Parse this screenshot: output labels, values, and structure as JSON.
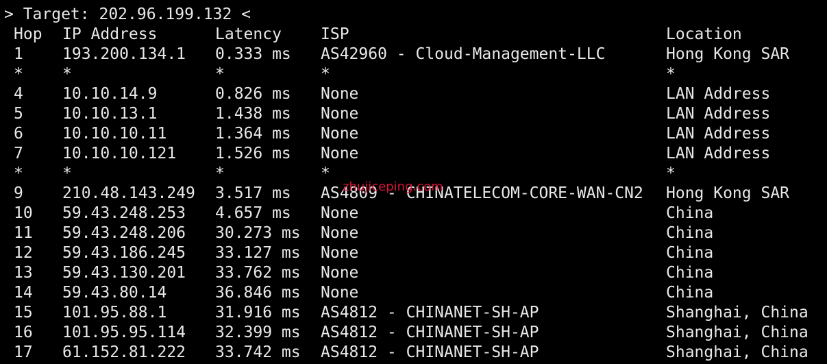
{
  "terminal": {
    "target_line": "> Target: 202.96.199.132 <",
    "headers": {
      "hop": "Hop",
      "ip": "IP Address",
      "latency": "Latency",
      "isp": "ISP",
      "location": "Location"
    },
    "rows": [
      {
        "hop": "1",
        "ip": "193.200.134.1",
        "latency": "0.333 ms",
        "isp": "AS42960 - Cloud-Management-LLC",
        "location": "Hong Kong SAR"
      },
      {
        "hop": "*",
        "ip": "*",
        "latency": "*",
        "isp": "*",
        "location": "*"
      },
      {
        "hop": "4",
        "ip": "10.10.14.9",
        "latency": "0.826 ms",
        "isp": "None",
        "location": "LAN Address"
      },
      {
        "hop": "5",
        "ip": "10.10.13.1",
        "latency": "1.438 ms",
        "isp": "None",
        "location": "LAN Address"
      },
      {
        "hop": "6",
        "ip": "10.10.10.11",
        "latency": "1.364 ms",
        "isp": "None",
        "location": "LAN Address"
      },
      {
        "hop": "7",
        "ip": "10.10.10.121",
        "latency": "1.526 ms",
        "isp": "None",
        "location": "LAN Address"
      },
      {
        "hop": "*",
        "ip": "*",
        "latency": "*",
        "isp": "*",
        "location": "*"
      },
      {
        "hop": "9",
        "ip": "210.48.143.249",
        "latency": "3.517 ms",
        "isp": "AS4809 - CHINATELECOM-CORE-WAN-CN2",
        "location": "Hong Kong SAR"
      },
      {
        "hop": "10",
        "ip": "59.43.248.253",
        "latency": "4.657 ms",
        "isp": "None",
        "location": "China"
      },
      {
        "hop": "11",
        "ip": "59.43.248.206",
        "latency": "30.273 ms",
        "isp": "None",
        "location": "China"
      },
      {
        "hop": "12",
        "ip": "59.43.186.245",
        "latency": "33.127 ms",
        "isp": "None",
        "location": "China"
      },
      {
        "hop": "13",
        "ip": "59.43.130.201",
        "latency": "33.762 ms",
        "isp": "None",
        "location": "China"
      },
      {
        "hop": "14",
        "ip": "59.43.80.14",
        "latency": "36.846 ms",
        "isp": "None",
        "location": "China"
      },
      {
        "hop": "15",
        "ip": "101.95.88.1",
        "latency": "31.916 ms",
        "isp": "AS4812 - CHINANET-SH-AP",
        "location": "Shanghai, China"
      },
      {
        "hop": "16",
        "ip": "101.95.95.114",
        "latency": "32.399 ms",
        "isp": "AS4812 - CHINANET-SH-AP",
        "location": "Shanghai, China"
      },
      {
        "hop": "17",
        "ip": "61.152.81.222",
        "latency": "33.742 ms",
        "isp": "AS4812 - CHINANET-SH-AP",
        "location": "Shanghai, China"
      }
    ]
  },
  "watermark": "zhujiceping.com",
  "colors": {
    "background": "#000000",
    "text": "#e8e8e8",
    "watermark": "#e0163a"
  }
}
